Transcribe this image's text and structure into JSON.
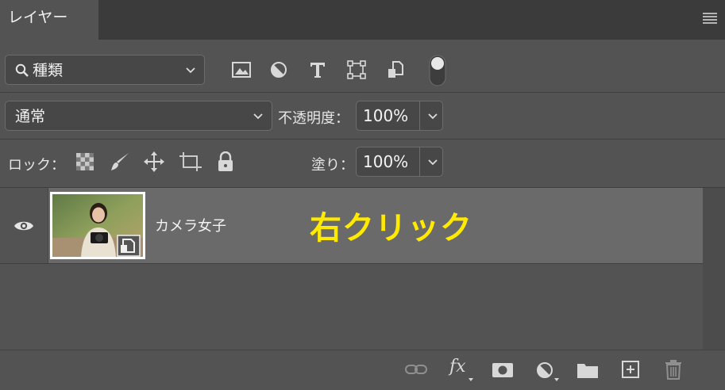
{
  "panel": {
    "tab_label": "レイヤー",
    "menu_icon": "panel-menu-icon"
  },
  "filter": {
    "selected": "種類",
    "search_icon": "search-icon",
    "filter_icons": [
      "image-filter-icon",
      "adjustment-filter-icon",
      "text-filter-icon",
      "shape-filter-icon",
      "smart-object-filter-icon",
      "filter-toggle-icon"
    ]
  },
  "blend": {
    "mode": "通常",
    "opacity_label": "不透明度：",
    "opacity_value": "100%"
  },
  "lock": {
    "label": "ロック：",
    "icons": [
      "lock-transparent-pixels-icon",
      "lock-image-pixels-icon",
      "lock-position-icon",
      "lock-artboard-icon",
      "lock-all-icon"
    ],
    "fill_label": "塗り：",
    "fill_value": "100%"
  },
  "layers": [
    {
      "name": "カメラ女子",
      "visible": true,
      "type": "smart-object"
    }
  ],
  "annotation": "右クリック",
  "bottom_toolbar": [
    "link-layers-icon",
    "fx-icon",
    "add-mask-icon",
    "new-adjustment-icon",
    "new-group-icon",
    "new-layer-icon",
    "delete-layer-icon"
  ],
  "fx_label": "fx",
  "colors": {
    "panel_bg": "#535353",
    "selected_row": "#6a6a6a",
    "annotation": "#ffea00"
  }
}
